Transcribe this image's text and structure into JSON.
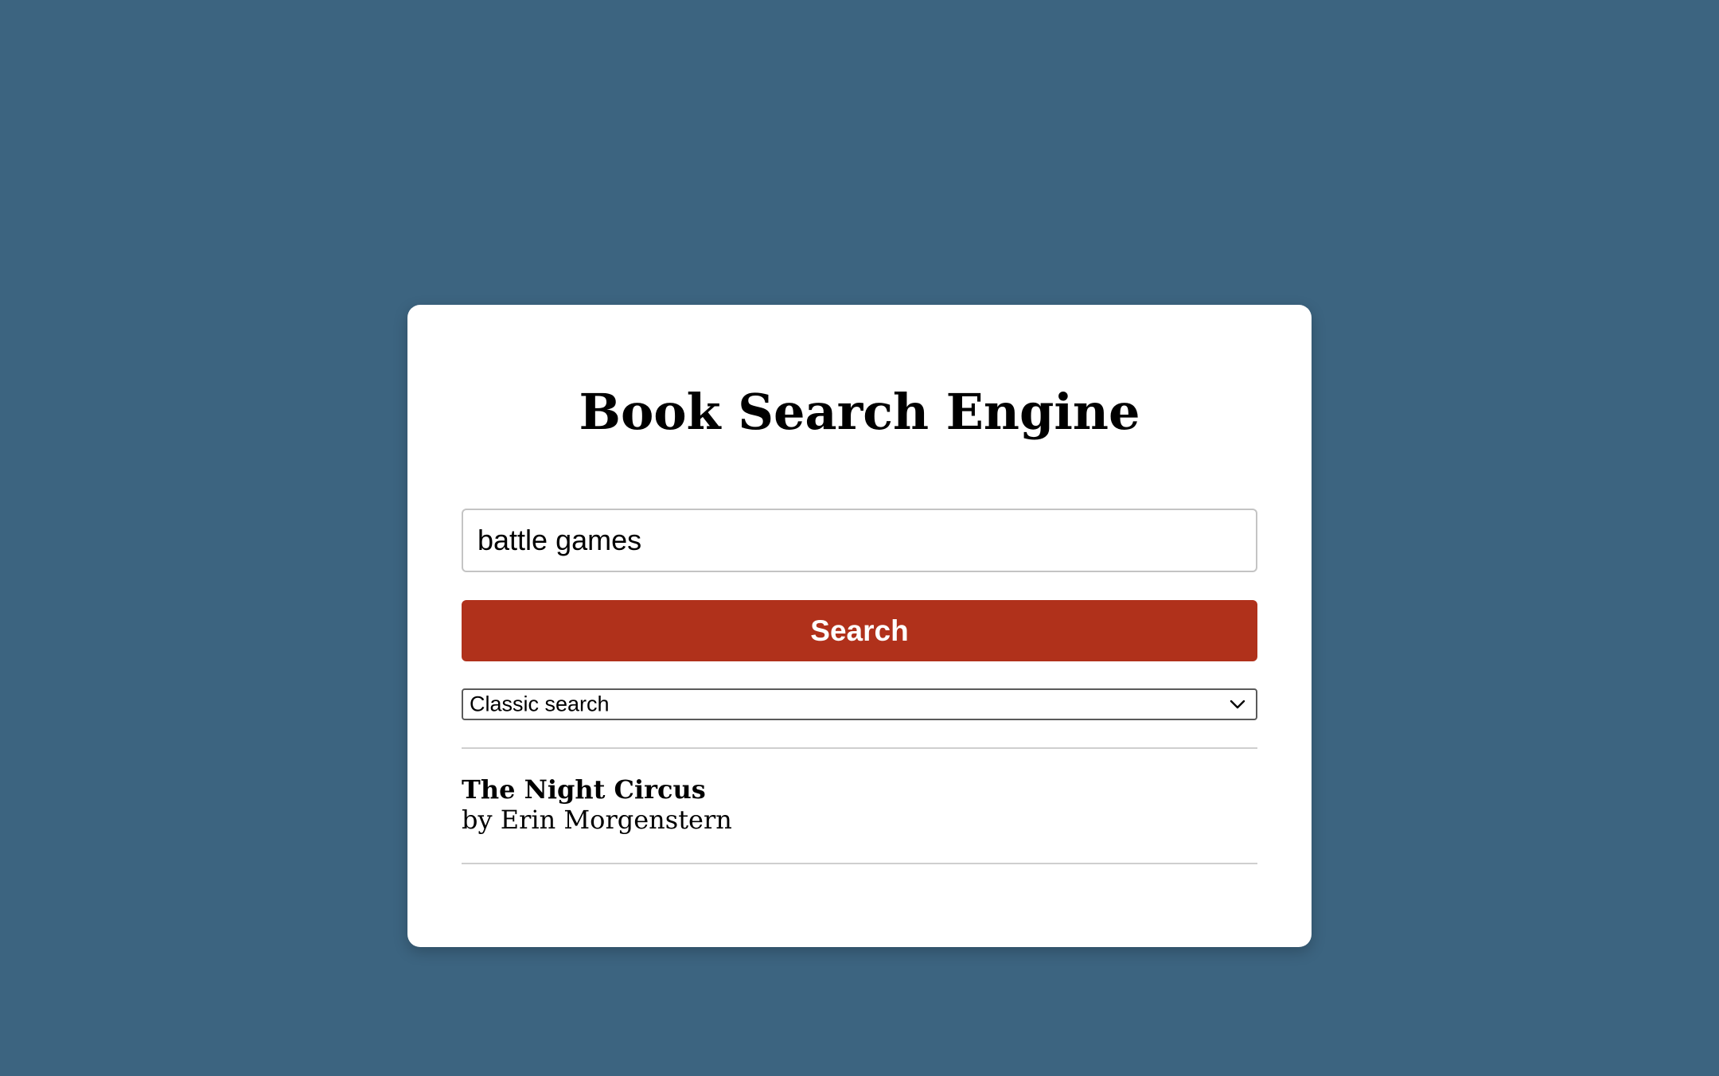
{
  "page": {
    "background_color": "#3c6480",
    "card_color": "#ffffff"
  },
  "header": {
    "title": "Book Search Engine"
  },
  "search": {
    "query": "battle games",
    "button_label": "Search",
    "button_color": "#b0311b"
  },
  "mode_select": {
    "selected": "Classic search",
    "icon": "chevron-down-icon"
  },
  "results": [
    {
      "title": "The Night Circus",
      "author_line": "by Erin Morgenstern"
    }
  ]
}
